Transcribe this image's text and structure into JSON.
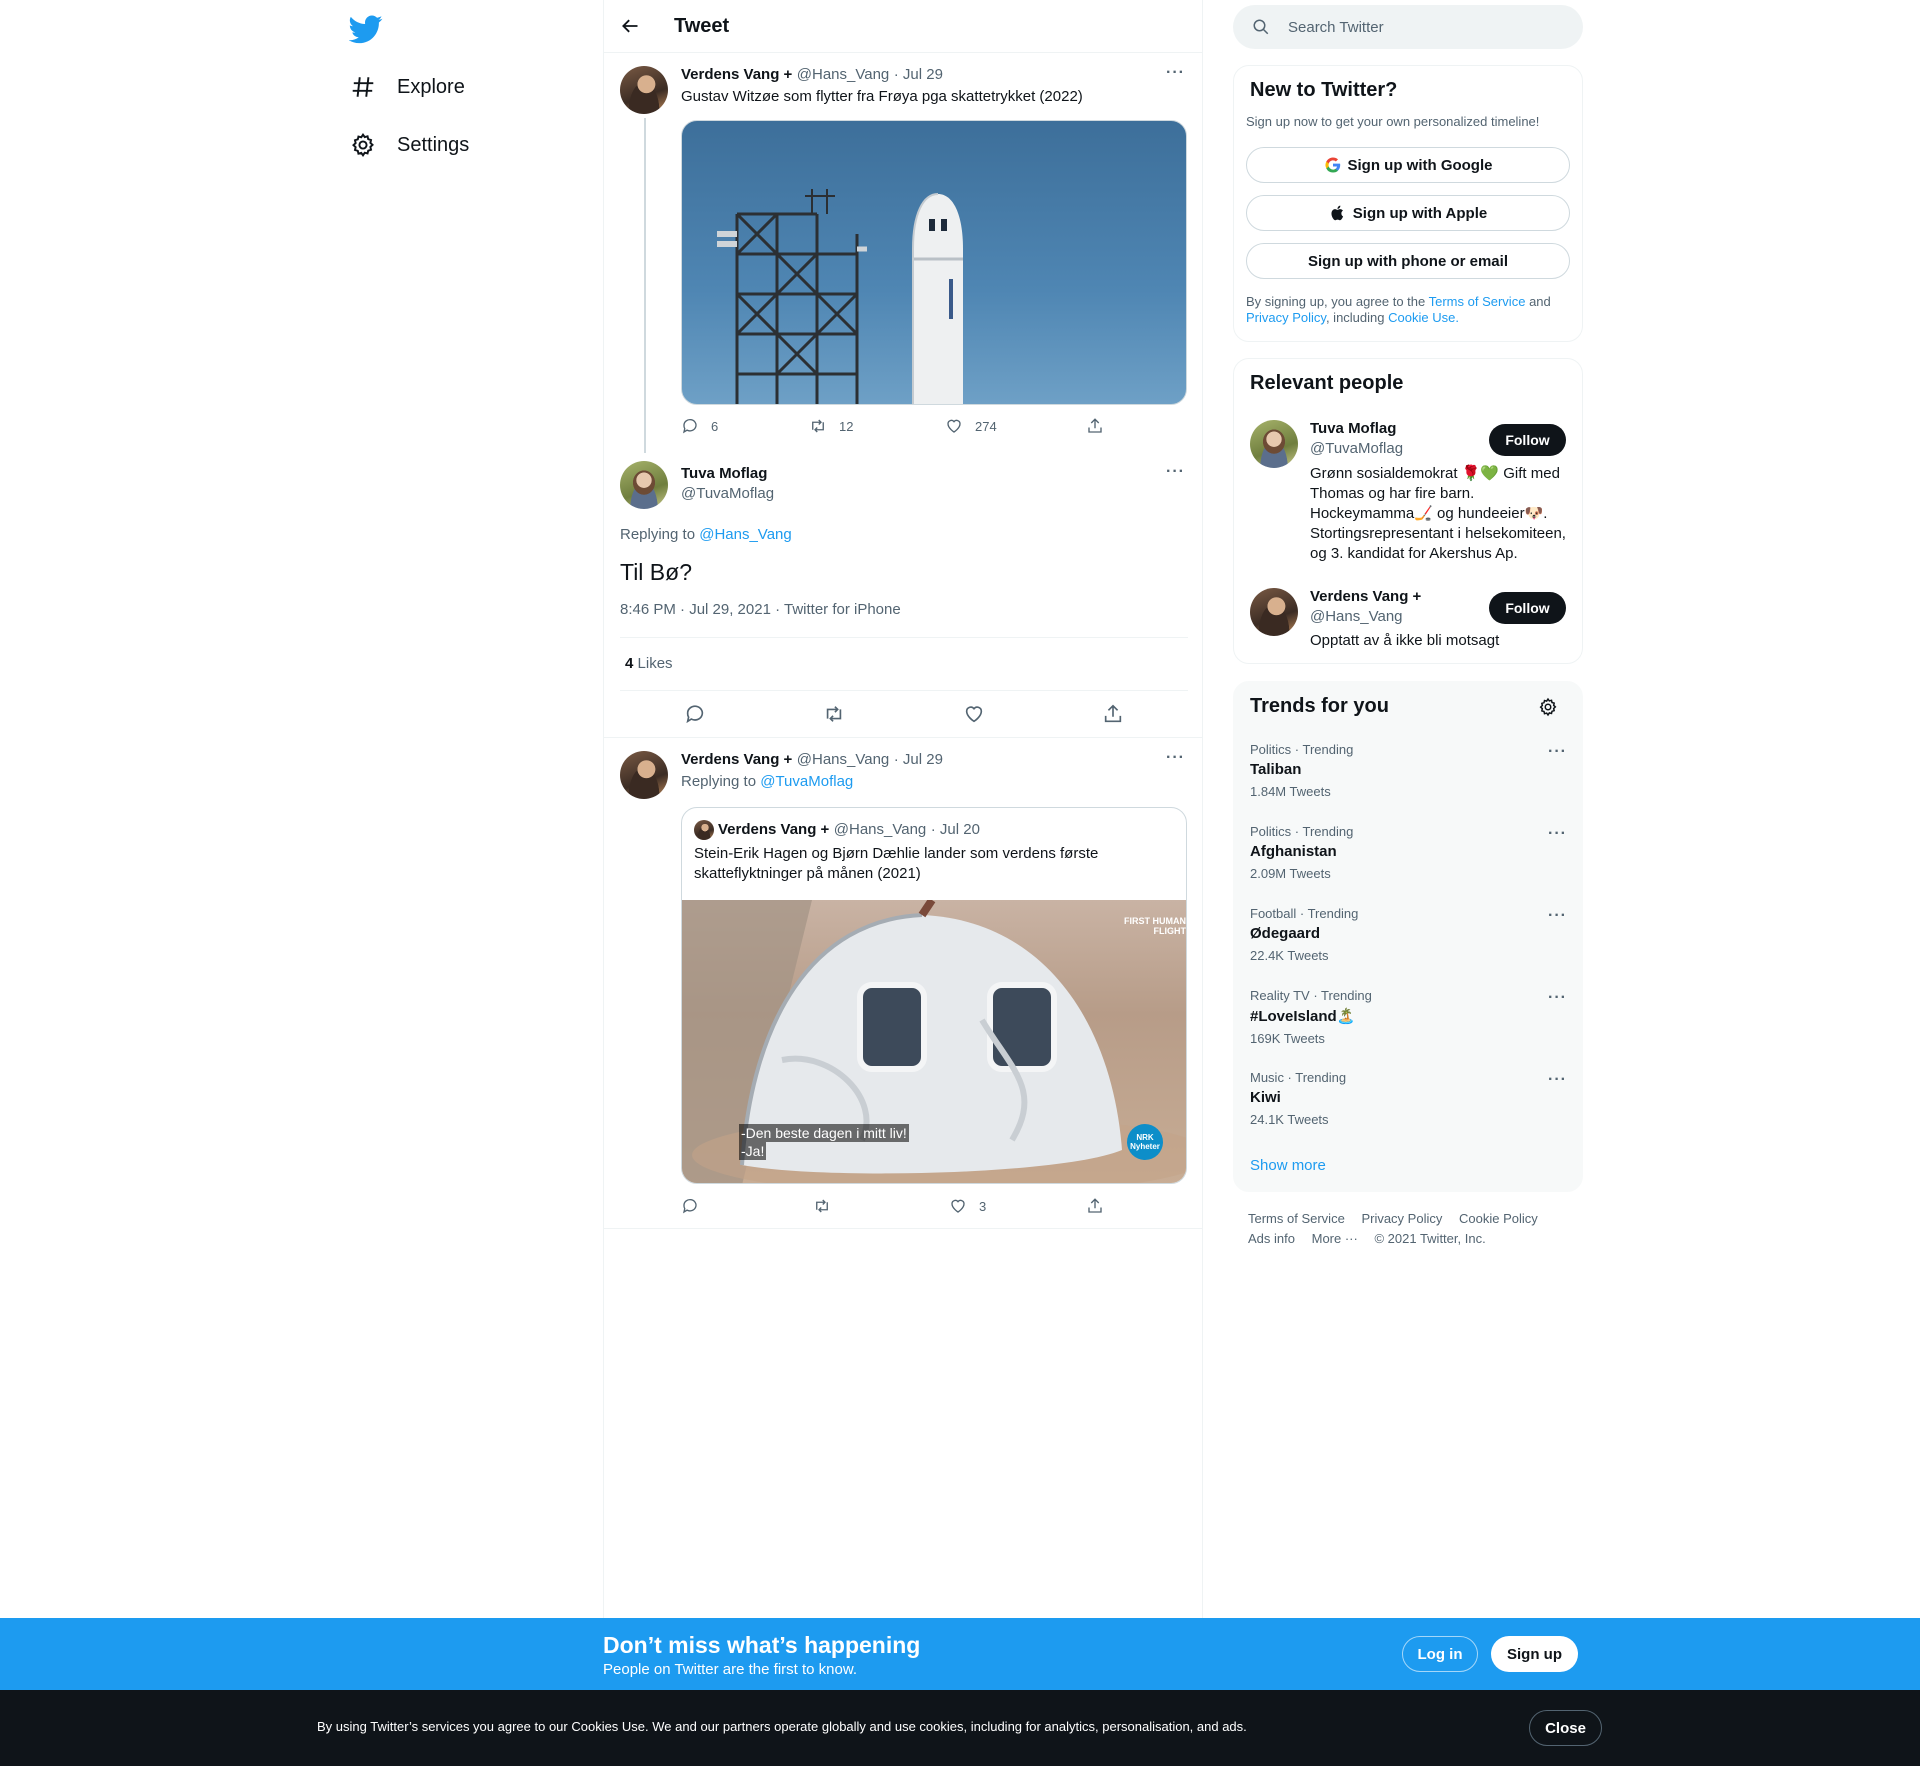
{
  "nav": {
    "items": [
      {
        "label": "Explore",
        "icon": "hashtag-icon"
      },
      {
        "label": "Settings",
        "icon": "gear-icon"
      }
    ]
  },
  "header": {
    "title": "Tweet"
  },
  "thread": {
    "tweet1": {
      "name": "Verdens Vang +",
      "handle": "@Hans_Vang",
      "date": "· Jul 29",
      "text": "Gustav Witzøe som flytter fra Frøya pga skattetrykket (2022)",
      "replies": "6",
      "retweets": "12",
      "likes": "274"
    },
    "main": {
      "name": "Tuva Moflag",
      "handle": "@TuvaMoflag",
      "replying_prefix": "Replying to",
      "replying_to": "@Hans_Vang",
      "text": "Til Bø?",
      "timestamp": "8:46 PM · Jul 29, 2021 · Twitter for iPhone",
      "likes_count": "4",
      "likes_label": "Likes"
    },
    "reply": {
      "name": "Verdens Vang +",
      "handle": "@Hans_Vang",
      "date": "· Jul 29",
      "replying_prefix": "Replying to",
      "replying_to": "@TuvaMoflag",
      "likes": "3",
      "quote": {
        "name": "Verdens Vang +",
        "handle": "@Hans_Vang",
        "date": "· Jul 20",
        "text_line1": "Stein-Erik Hagen og Bjørn Dæhlie lander som verdens første",
        "text_line2": "skatteflyktninger på månen (2021)",
        "subtitle1": "-Den beste dagen i mitt liv!",
        "subtitle2": "-Ja!",
        "overlay_top": "FIRST HUMAN",
        "overlay_bottom": "FLIGHT",
        "badge_line1": "NRK",
        "badge_line2": "Nyheter"
      }
    }
  },
  "search": {
    "placeholder": "Search Twitter"
  },
  "new_to_twitter": {
    "title": "New to Twitter?",
    "subtitle": "Sign up now to get your own personalized timeline!",
    "google": "Sign up with Google",
    "apple": "Sign up with Apple",
    "phone": "Sign up with phone or email",
    "legal_prefix": "By signing up, you agree to the",
    "terms": "Terms of Service",
    "and": "and",
    "privacy": "Privacy Policy",
    "including": ", including",
    "cookie": "Cookie Use."
  },
  "relevant_people": {
    "title": "Relevant people",
    "people": [
      {
        "name": "Tuva Moflag",
        "handle": "@TuvaMoflag",
        "follow": "Follow",
        "bio1": "Grønn sosialdemokrat 🌹💚 Gift med",
        "bio2": "Thomas og har fire barn.",
        "bio3": "Hockeymamma🏒 og hundeeier🐶.",
        "bio4": "Stortingsrepresentant i helsekomiteen,",
        "bio5": "og 3. kandidat for Akershus Ap."
      },
      {
        "name": "Verdens Vang +",
        "handle": "@Hans_Vang",
        "follow": "Follow",
        "bio1": "Opptatt av å ikke bli motsagt"
      }
    ]
  },
  "trends": {
    "title": "Trends for you",
    "items": [
      {
        "category": "Politics · Trending",
        "name": "Taliban",
        "count": "1.84M Tweets"
      },
      {
        "category": "Politics · Trending",
        "name": "Afghanistan",
        "count": "2.09M Tweets"
      },
      {
        "category": "Football · Trending",
        "name": "Ødegaard",
        "count": "22.4K Tweets"
      },
      {
        "category": "Reality TV · Trending",
        "name": "#LoveIsland🏝️",
        "count": "169K Tweets"
      },
      {
        "category": "Music · Trending",
        "name": "Kiwi",
        "count": "24.1K Tweets"
      }
    ],
    "show_more": "Show more"
  },
  "footer": {
    "terms": "Terms of Service",
    "privacy": "Privacy Policy",
    "cookie": "Cookie Policy",
    "ads": "Ads info",
    "more": "More ···",
    "copyright": "© 2021 Twitter, Inc."
  },
  "signup_bar": {
    "title": "Don’t miss what’s happening",
    "subtitle": "People on Twitter are the first to know.",
    "login": "Log in",
    "signup": "Sign up"
  },
  "cookie_bar": {
    "text": "By using Twitter’s services you agree to our Cookies Use. We and our partners operate globally and use cookies, including for analytics, personalisation, and ads.",
    "close": "Close"
  },
  "colors": {
    "accent": "#1d9bf0",
    "text": "#0f1419",
    "muted": "#536471",
    "border": "#eff3f4"
  }
}
